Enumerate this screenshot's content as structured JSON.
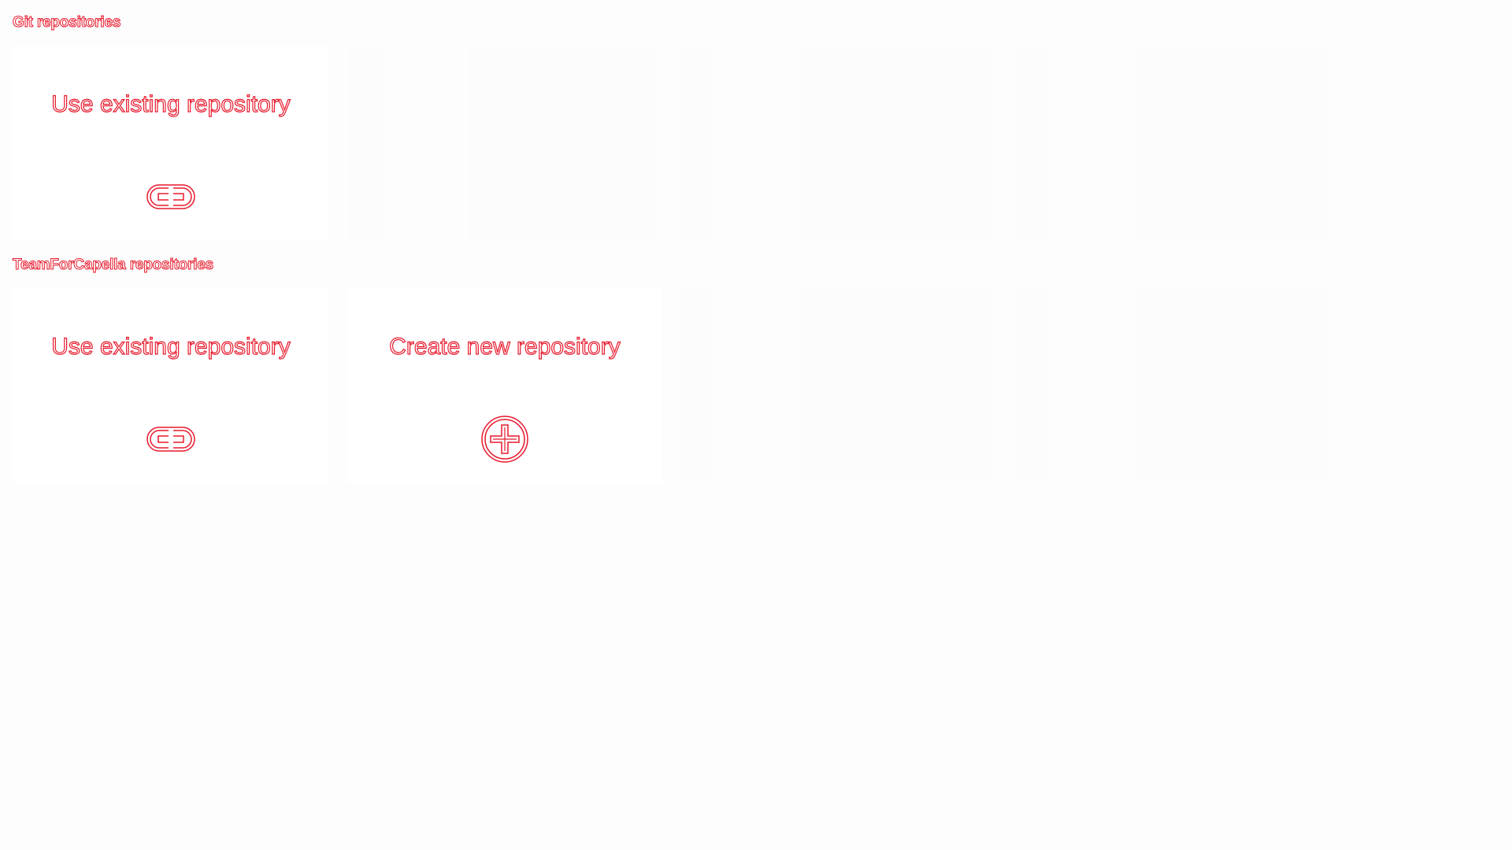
{
  "sections": [
    {
      "title": "Git repositories",
      "cards": [
        {
          "label": "Use existing repository",
          "icon": "link-icon"
        }
      ]
    },
    {
      "title": "TeamForCapella repositories",
      "cards": [
        {
          "label": "Use existing repository",
          "icon": "link-icon"
        },
        {
          "label": "Create new repository",
          "icon": "plus-circle-icon"
        }
      ]
    }
  ],
  "colors": {
    "accent": "#e8192c",
    "background": "#fdfdfd",
    "card": "#ffffff"
  }
}
